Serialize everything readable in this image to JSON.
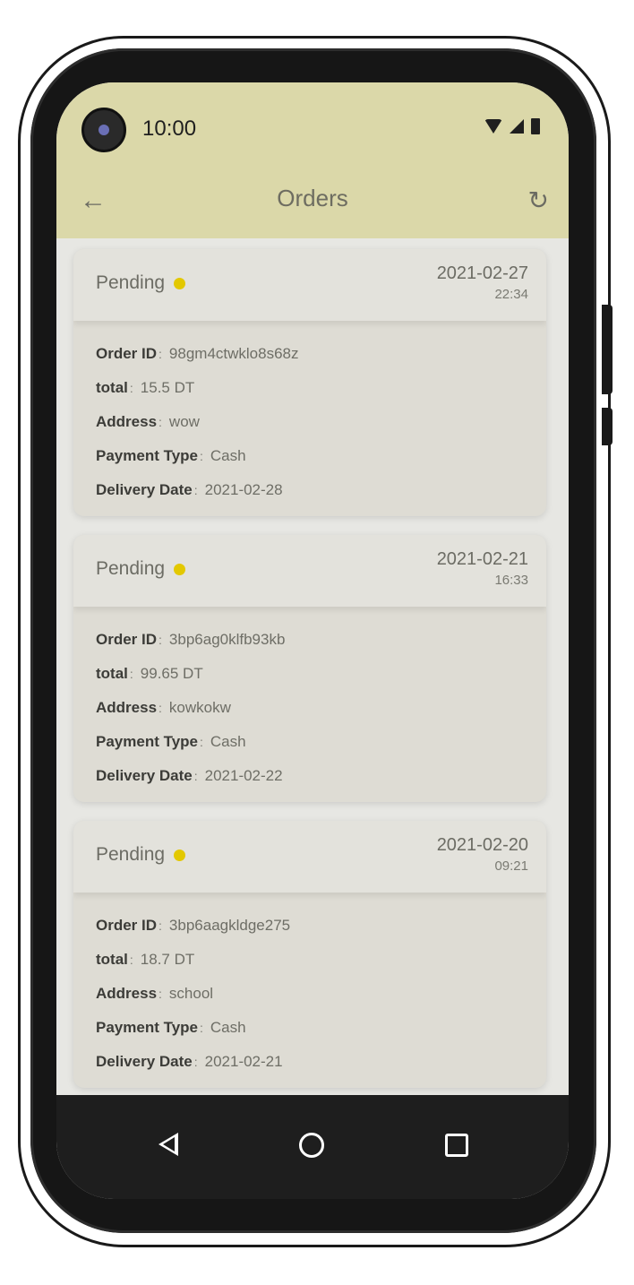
{
  "status_bar": {
    "time": "10:00"
  },
  "app_bar": {
    "title": "Orders",
    "back_icon": "arrow-left-icon",
    "refresh_icon": "refresh-icon"
  },
  "labels": {
    "order_id": "Order ID",
    "total": "total",
    "address": "Address",
    "payment_type": "Payment Type",
    "delivery_date": "Delivery Date",
    "separator": ":"
  },
  "orders": [
    {
      "status": "Pending",
      "date": "2021-02-27",
      "time": "22:34",
      "order_id": "98gm4ctwklo8s68z",
      "total": "15.5 DT",
      "address": "wow",
      "payment_type": "Cash",
      "delivery_date": "2021-02-28"
    },
    {
      "status": "Pending",
      "date": "2021-02-21",
      "time": "16:33",
      "order_id": "3bp6ag0klfb93kb",
      "total": "99.65 DT",
      "address": "kowkokw",
      "payment_type": "Cash",
      "delivery_date": "2021-02-22"
    },
    {
      "status": "Pending",
      "date": "2021-02-20",
      "time": "09:21",
      "order_id": "3bp6aagkldge275",
      "total": "18.7 DT",
      "address": "school",
      "payment_type": "Cash",
      "delivery_date": "2021-02-21"
    }
  ],
  "colors": {
    "app_bar": "#dbd8a9",
    "status_dot": "#e3c800",
    "nav_bar": "#1e1e1e"
  }
}
